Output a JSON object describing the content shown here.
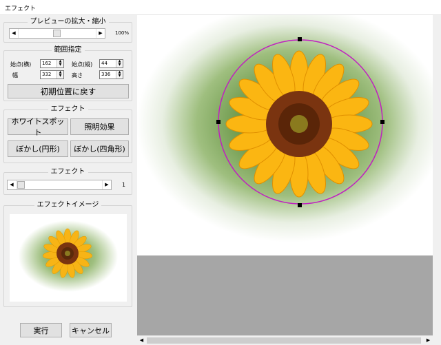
{
  "window": {
    "title": "エフェクト"
  },
  "zoom": {
    "group_label": "プレビューの拡大・縮小",
    "value_text": "100%",
    "slider_level": 0.5
  },
  "range": {
    "group_label": "範囲指定",
    "start_x_label": "始点(横)",
    "start_x_value": "162",
    "start_y_label": "始点(縦)",
    "start_y_value": "44",
    "width_label": "幅",
    "width_value": "332",
    "height_label": "高さ",
    "height_value": "336",
    "reset_label": "初期位置に戻す"
  },
  "effect_buttons": {
    "group_label": "エフェクト",
    "white_spot": "ホワイトスポット",
    "lighting": "照明効果",
    "blur_circle": "ぼかし(円形)",
    "blur_square": "ぼかし(四角形)"
  },
  "effect_strength": {
    "group_label": "エフェクト",
    "value_text": "1",
    "slider_level": 0.0
  },
  "effect_image": {
    "group_label": "エフェクトイメージ"
  },
  "actions": {
    "run": "実行",
    "cancel": "キャンセル"
  },
  "colors": {
    "selection_circle": "#c020c0",
    "gray_fill": "#a6a6a6"
  }
}
